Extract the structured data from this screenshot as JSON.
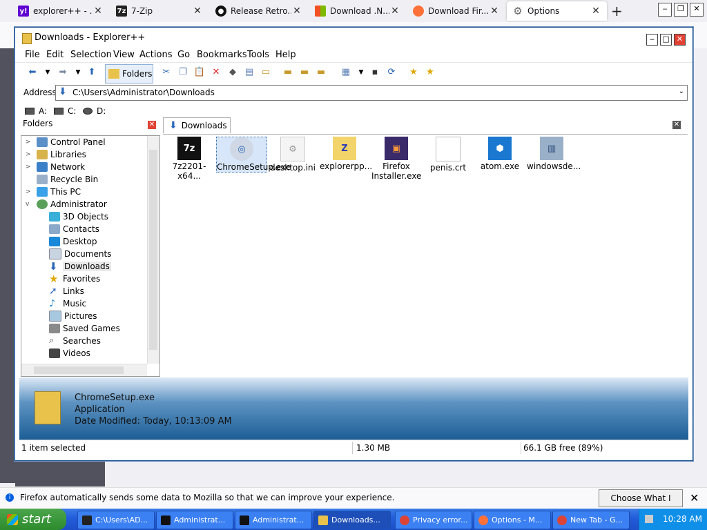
{
  "browser": {
    "tabs": [
      {
        "label": "explorer++ - ...",
        "favicon": "yahoo-icon",
        "color": "#6001d2"
      },
      {
        "label": "7-Zip",
        "favicon": "7zip-icon",
        "color": "#222222"
      },
      {
        "label": "Release Retro...",
        "favicon": "github-icon",
        "color": "#111111"
      },
      {
        "label": "Download .N...",
        "favicon": "microsoft-icon",
        "color": "#00a4ef"
      },
      {
        "label": "Download Fir...",
        "favicon": "firefox-icon",
        "color": "#ff7139"
      },
      {
        "label": "Options",
        "favicon": "gear-icon",
        "color": "#666666"
      }
    ]
  },
  "explorer": {
    "title": "Downloads - Explorer++",
    "menu": [
      "File",
      "Edit",
      "Selection",
      "View",
      "Actions",
      "Go",
      "Bookmarks",
      "Tools",
      "Help"
    ],
    "folders_button": "Folders",
    "address_label": "Address",
    "address_path": "C:\\Users\\Administrator\\Downloads",
    "drives": [
      "A:",
      "C:",
      "D:"
    ],
    "folders_title": "Folders",
    "tree": [
      {
        "label": "Control Panel",
        "indent": 0,
        "expander": ">"
      },
      {
        "label": "Libraries",
        "indent": 0,
        "expander": ">"
      },
      {
        "label": "Network",
        "indent": 0,
        "expander": ">"
      },
      {
        "label": "Recycle Bin",
        "indent": 0,
        "expander": ""
      },
      {
        "label": "This PC",
        "indent": 0,
        "expander": ">"
      },
      {
        "label": "Administrator",
        "indent": 0,
        "expander": "v"
      },
      {
        "label": "3D Objects",
        "indent": 1,
        "expander": ""
      },
      {
        "label": "Contacts",
        "indent": 1,
        "expander": ""
      },
      {
        "label": "Desktop",
        "indent": 1,
        "expander": ""
      },
      {
        "label": "Documents",
        "indent": 1,
        "expander": ""
      },
      {
        "label": "Downloads",
        "indent": 1,
        "expander": ""
      },
      {
        "label": "Favorites",
        "indent": 1,
        "expander": ""
      },
      {
        "label": "Links",
        "indent": 1,
        "expander": ""
      },
      {
        "label": "Music",
        "indent": 1,
        "expander": ""
      },
      {
        "label": "Pictures",
        "indent": 1,
        "expander": ""
      },
      {
        "label": "Saved Games",
        "indent": 1,
        "expander": ""
      },
      {
        "label": "Searches",
        "indent": 1,
        "expander": ""
      },
      {
        "label": "Videos",
        "indent": 1,
        "expander": ""
      }
    ],
    "tab_label": "Downloads",
    "files": [
      {
        "name": "7z2201-x64...",
        "icon": "7zip-icon"
      },
      {
        "name": "ChromeSetup.exe",
        "icon": "installer-icon"
      },
      {
        "name": "desktop.ini",
        "icon": "settings-file-icon"
      },
      {
        "name": "explorerpp...",
        "icon": "zip-folder-icon"
      },
      {
        "name": "Firefox Installer.exe",
        "icon": "firefox-installer-icon"
      },
      {
        "name": "penis.crt",
        "icon": "file-icon"
      },
      {
        "name": "atom.exe",
        "icon": "atom-icon"
      },
      {
        "name": "windowsde...",
        "icon": "setup-icon"
      }
    ],
    "info": {
      "name": "ChromeSetup.exe",
      "type": "Application",
      "modified": "Date Modified: Today, 10:13:09 AM"
    },
    "status": {
      "selected": "1 item selected",
      "size": "1.30 MB",
      "free": "66.1 GB free (89%)"
    }
  },
  "notification": {
    "text": "Firefox automatically sends some data to Mozilla so that we can improve your experience.",
    "button": "Choose What I Share"
  },
  "taskbar": {
    "start": "start",
    "tasks": [
      "C:\\Users\\AD...",
      "Administrat...",
      "Administrat...",
      "Downloads...",
      "Privacy error...",
      "Options - M...",
      "New Tab - G..."
    ],
    "clock": "10:28 AM"
  }
}
